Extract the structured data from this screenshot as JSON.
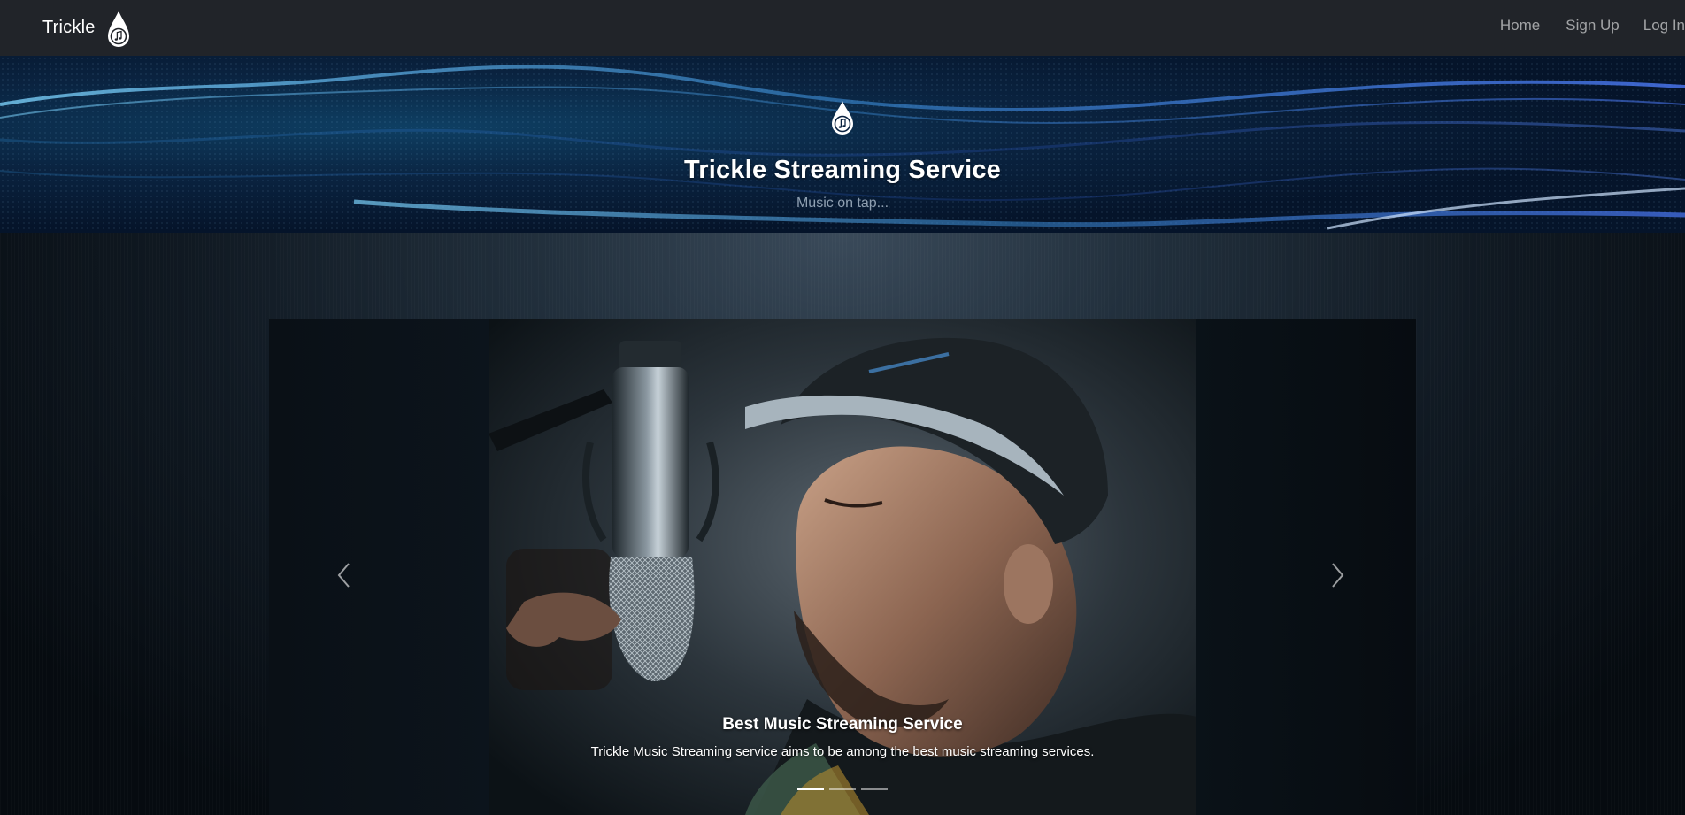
{
  "navbar": {
    "brand": "Trickle",
    "brand_icon": "music-drop-icon",
    "links": [
      {
        "label": "Home"
      },
      {
        "label": "Sign Up"
      },
      {
        "label": "Log In"
      }
    ]
  },
  "hero": {
    "icon": "music-drop-icon",
    "title": "Trickle Streaming Service",
    "subtitle": "Music on tap..."
  },
  "carousel": {
    "slide": {
      "image": "singer-microphone-photo",
      "caption_title": "Best Music Streaming Service",
      "caption_text": "Trickle Music Streaming service aims to be among the best music streaming services."
    },
    "prev_icon": "chevron-left-icon",
    "next_icon": "chevron-right-icon",
    "indicators": 3,
    "active_index": 0
  },
  "colors": {
    "navbar_bg": "#212429",
    "nav_link": "#8f9296",
    "hero_accent": "#3aa0e0"
  }
}
